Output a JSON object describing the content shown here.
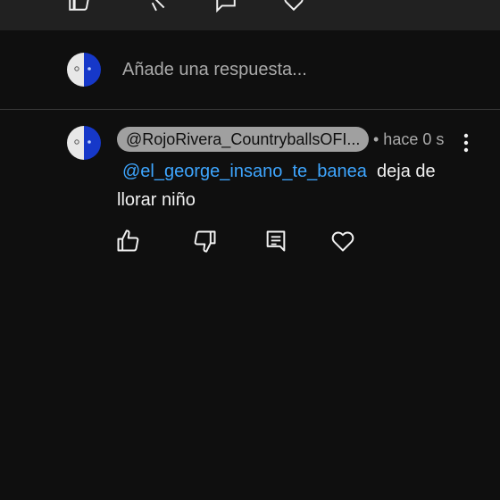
{
  "reply_box": {
    "placeholder": "Añade una respuesta..."
  },
  "comment": {
    "author": "@RojoRivera_CountryballsOFI...",
    "time": "• hace 0 s",
    "mention": "@el_george_insano_te_banea",
    "text": "deja de llorar niño"
  },
  "icons": {
    "top": [
      "thumbs-up-icon",
      "dislike-icon",
      "comment-icon",
      "heart-icon"
    ],
    "actions": [
      "thumbs-up-icon",
      "thumbs-down-icon",
      "reply-icon",
      "heart-icon"
    ],
    "more": "more-vert-icon"
  },
  "colors": {
    "mention": "#3ea6ff",
    "avatar_blue": "#1638c9"
  }
}
